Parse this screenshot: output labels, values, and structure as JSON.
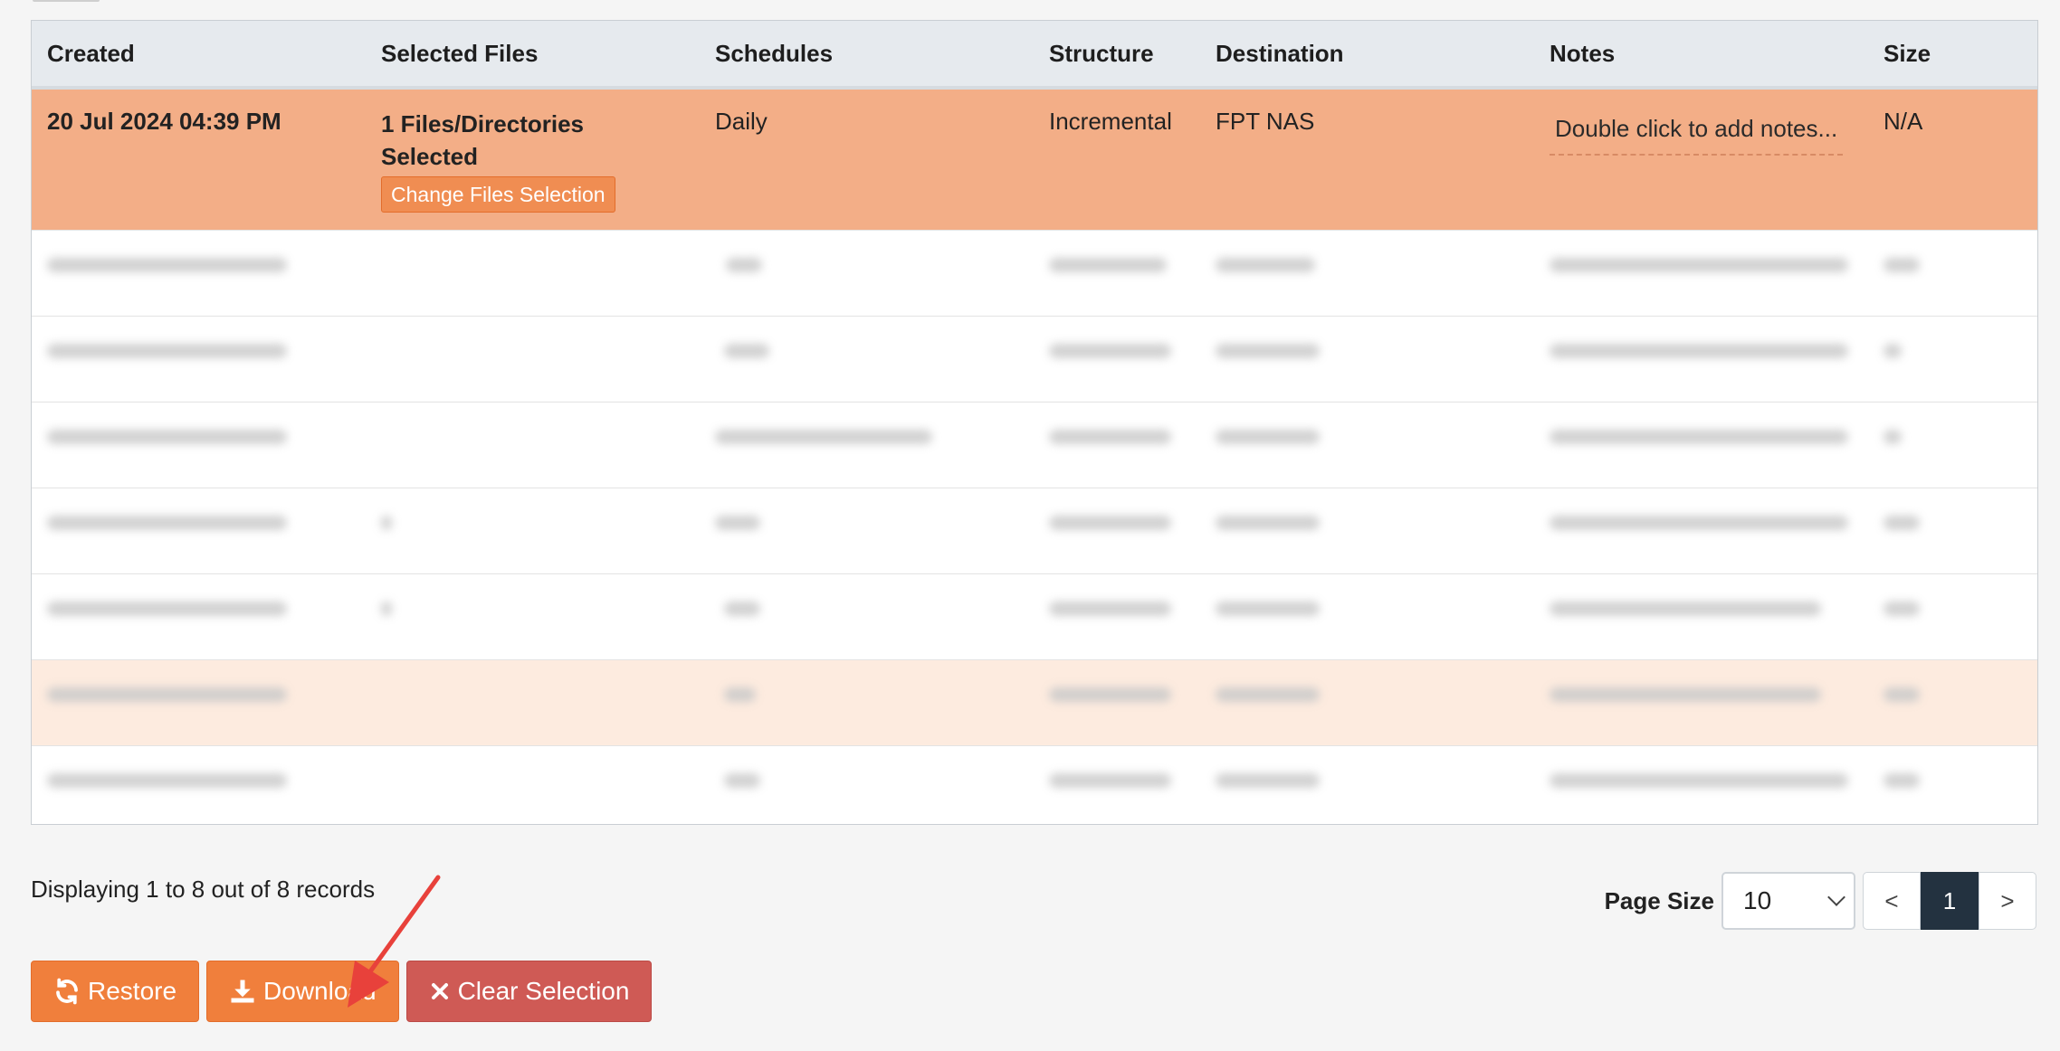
{
  "table": {
    "headers": [
      "Created",
      "Selected Files",
      "Schedules",
      "Structure",
      "Destination",
      "Notes",
      "Size"
    ],
    "selected_row": {
      "created": "20 Jul 2024 04:39 PM",
      "files_line1": "1 Files/Directories",
      "files_line2": "Selected",
      "change_files_label": "Change Files Selection",
      "schedule": "Daily",
      "structure": "Incremental",
      "destination": "FPT NAS",
      "notes": "Double click to add notes...",
      "size": "N/A"
    }
  },
  "footer": {
    "records_text": "Displaying 1 to 8 out of 8 records",
    "page_size_label": "Page Size",
    "page_size_value": "10",
    "prev_label": "<",
    "current_page": "1",
    "next_label": ">"
  },
  "actions": {
    "restore_label": "Restore",
    "download_label": "Download",
    "clear_label": "Clear Selection"
  },
  "colors": {
    "selected_row": "#f3ae87",
    "primary_button": "#f07f3c",
    "danger_button": "#cf5a55",
    "active_page": "#233240",
    "annotation_arrow": "#e8413b"
  }
}
